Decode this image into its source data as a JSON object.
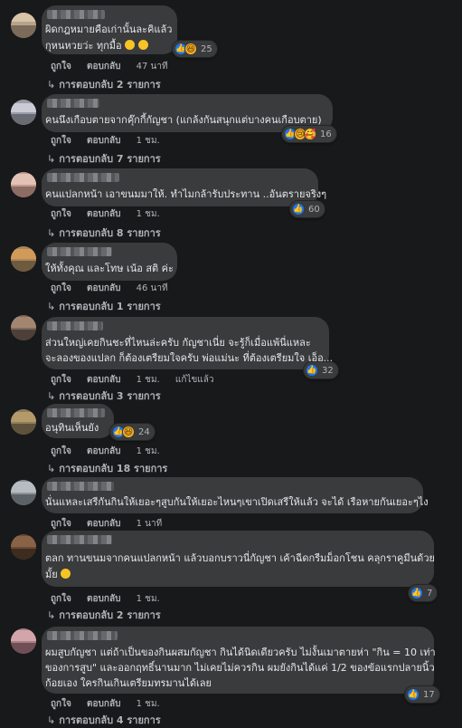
{
  "labels": {
    "like": "ถูกใจ",
    "reply": "ตอบกลับ",
    "edited": "แก้ไขแล้ว"
  },
  "comments": [
    {
      "lines": [
        "ผิดกฎหมายคือเก่านั้นละคิแล้ว",
        "กุหนหวยว่ะ ทุกมื้อ"
      ],
      "time": "47 นาที",
      "reactions": "25",
      "replies": "การตอบกลับ 2 รายการ"
    },
    {
      "lines": [
        "คนนึงเกือบตายจากคุ๊กกี้กัญชา (แกล้งกันสนุกแต่บางคนเกือบตาย)"
      ],
      "time": "1 ชม.",
      "reactions": "16",
      "replies": "การตอบกลับ 7 รายการ"
    },
    {
      "lines": [
        "คนแปลกหน้า เอาขนมมาให้. ทำไมกล้ารับประทาน ..อันตรายจริงๆ"
      ],
      "time": "1 ชม.",
      "reactions": "60",
      "replies": "การตอบกลับ 8 รายการ"
    },
    {
      "lines": [
        "ให้ทั้งคุณ และโทษ เน้อ สติ ค่ะ"
      ],
      "time": "46 นาที",
      "reactions": "",
      "replies": "การตอบกลับ 1 รายการ"
    },
    {
      "lines": [
        "ส่วนใหญ่เคยกินชะที่ไหนล่ะครับ กัญชาเนี่ย จะรู้ก็เมื่อแพ้นี่แหละ",
        "จะลองของแปลก ก็ต้องเตรียมใจครับ พ่อแม่นะ ที่ต้องเตรียมใจ เอ็อ..."
      ],
      "time": "1 ชม.",
      "reactions": "32",
      "replies": "การตอบกลับ 3 รายการ"
    },
    {
      "lines": [
        "อนุทินเห็นยัง"
      ],
      "time": "1 ชม.",
      "reactions": "24",
      "replies": "การตอบกลับ 18 รายการ"
    },
    {
      "lines": [
        "นั่นแหละเสรีกันกินให้เยอะๆสูบกันให้เยอะไหนๆเขาเปิดเสรีให้แล้ว จะได้ เรือหายกันเยอะๆไง"
      ],
      "time": "1 นาที",
      "reactions": "",
      "replies": ""
    },
    {
      "lines": [
        "ตลก ทานขนมจากคนแปลกหน้า แล้วบอกบราวนี่กัญชา เค้าฉีดกรีมม็อกโชน คลุกราคูมีนด้วย",
        "มั้ย"
      ],
      "time": "1 ชม.",
      "reactions": "7",
      "replies": "การตอบกลับ 2 รายการ"
    },
    {
      "lines": [
        "ผมสูบกัญชา แต่ถ้าเป็นของกินผสมกัญชา กินได้นิดเดียวครับ ไม่งั้นเมาตายห่า \"กิน = 10 เท่า",
        "ของการสูบ\" และออกฤทธิ์นานมาก ไม่เคยไม่ควรกิน ผมยังกินได้แค่ 1/2 ของข้อแรกปลายนิ้ว",
        "ก้อยเอง ใครกินเกินเตรียมทรมานได้เลย"
      ],
      "time": "1 ชม.",
      "reactions": "17",
      "replies": "การตอบกลับ 4 รายการ"
    }
  ]
}
